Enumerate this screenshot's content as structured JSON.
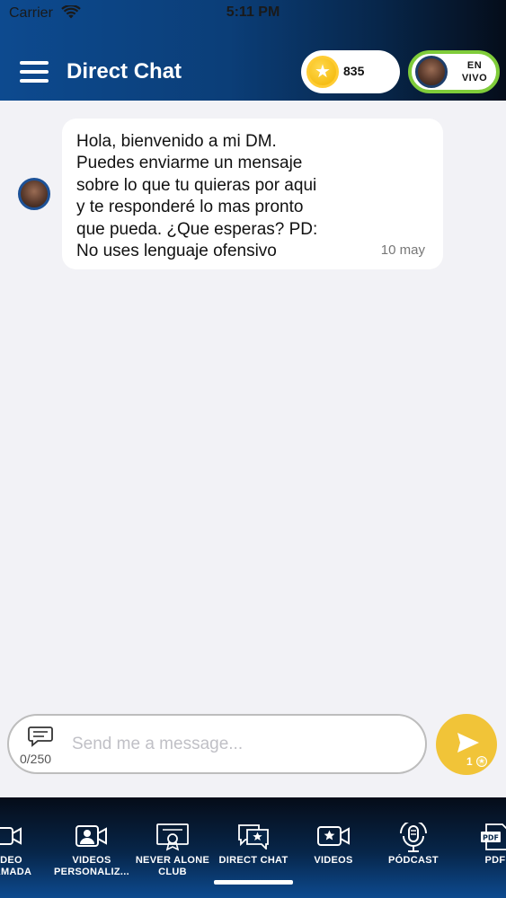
{
  "status_bar": {
    "carrier": "Carrier",
    "time": "5:11 PM"
  },
  "header": {
    "title": "Direct Chat",
    "coins": "835",
    "live_label_line1": "EN",
    "live_label_line2": "VIVO"
  },
  "message": {
    "text": "Hola, bienvenido a mi DM.\nPuedes enviarme un mensaje\nsobre lo que tu quieras por aqui\ny te responderé lo mas pronto\nque pueda. ¿Que esperas? PD:\nNo uses lenguaje ofensivo",
    "date": "10 may"
  },
  "composer": {
    "placeholder": "Send me a message...",
    "counter": "0/250",
    "send_cost": "1"
  },
  "nav": {
    "items": [
      {
        "label": "VIDEO\nLLAMADA",
        "icon": "video-call-icon"
      },
      {
        "label": "VIDEOS\nPERSONALIZ...",
        "icon": "personalized-video-icon"
      },
      {
        "label": "NEVER ALONE\nCLUB",
        "icon": "certificate-icon"
      },
      {
        "label": "DIRECT CHAT",
        "icon": "chat-star-icon"
      },
      {
        "label": "VIDEOS",
        "icon": "video-star-icon"
      },
      {
        "label": "PÓDCAST",
        "icon": "podcast-mic-icon"
      },
      {
        "label": "PDF",
        "icon": "pdf-icon"
      }
    ],
    "active": "DIRECT CHAT"
  },
  "colors": {
    "header_start": "#0d4a8f",
    "header_end": "#050d1a",
    "live_border": "#7fcc3a",
    "send_button": "#f1c438",
    "background": "#f2f2f6"
  }
}
